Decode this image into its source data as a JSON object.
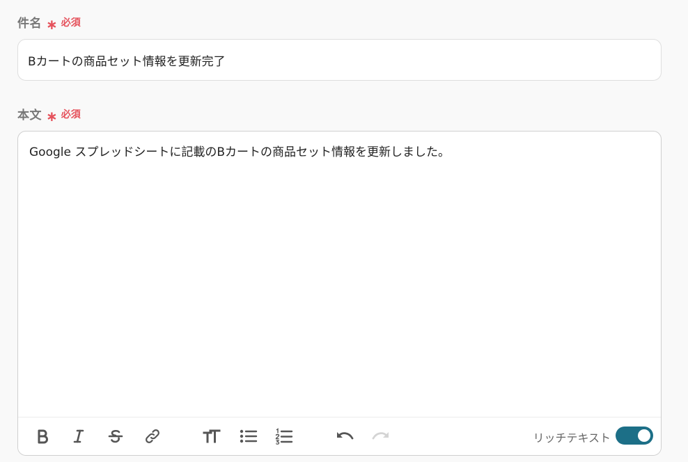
{
  "subject": {
    "label": "件名",
    "required_text": "必須",
    "value": "Bカートの商品セット情報を更新完了"
  },
  "body": {
    "label": "本文",
    "required_text": "必須",
    "value": "Google スプレッドシートに記載のBカートの商品セット情報を更新しました。"
  },
  "toolbar": {
    "buttons": [
      "bold-icon",
      "italic-icon",
      "strikethrough-icon",
      "link-icon",
      "text-size-icon",
      "bullet-list-icon",
      "numbered-list-icon",
      "undo-icon",
      "redo-icon"
    ],
    "rich_text_label": "リッチテキスト",
    "rich_text_enabled": true
  },
  "colors": {
    "required": "#e5525c",
    "toggle_on": "#1c6f87",
    "icon_active": "#555555",
    "icon_disabled": "#cccccc"
  }
}
